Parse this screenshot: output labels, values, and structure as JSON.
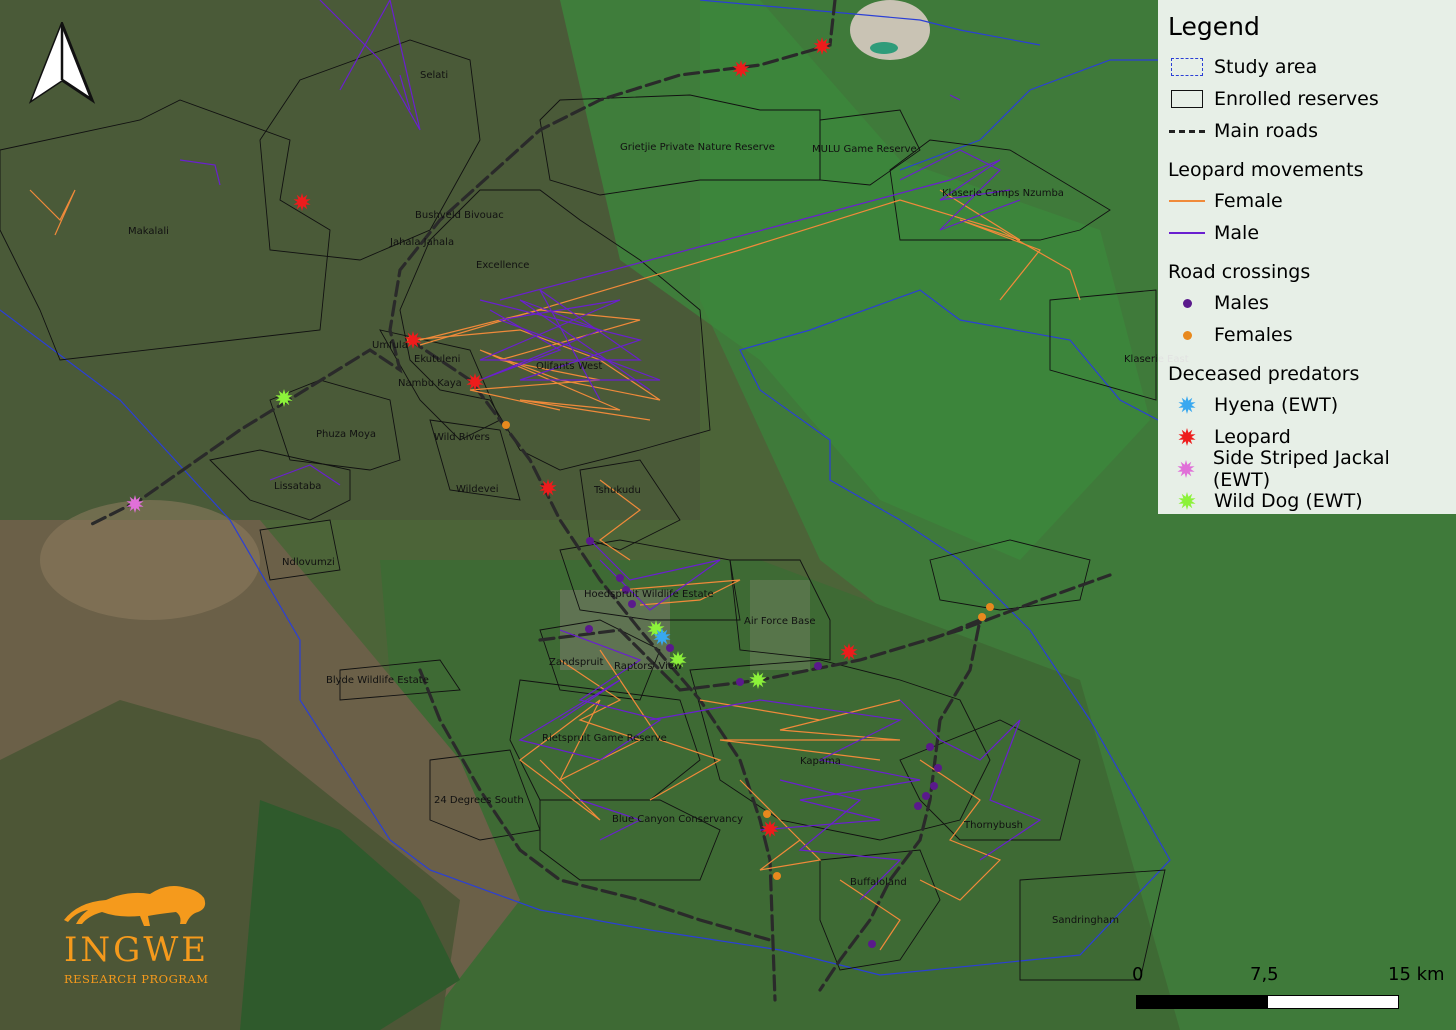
{
  "legend": {
    "title": "Legend",
    "items": {
      "study_area": "Study area",
      "enrolled_reserves": "Enrolled reserves",
      "main_roads": "Main roads",
      "leopard_movements": "Leopard movements",
      "female": "Female",
      "male": "Male",
      "road_crossings": "Road crossings",
      "males": "Males",
      "females": "Females",
      "deceased_predators": "Deceased predators",
      "hyena": "Hyena (EWT)",
      "leopard": "Leopard",
      "jackal": "Side Striped Jackal (EWT)",
      "wild_dog": "Wild Dog (EWT)"
    }
  },
  "colors": {
    "study_area": "#2b3fd6",
    "reserve_outline": "#111111",
    "road": "#2a2a2a",
    "female": "#f08a3a",
    "male": "#6a1fd0",
    "crossing_male": "#5a1a8c",
    "crossing_female": "#e8891e",
    "hyena": "#38a8f0",
    "leopard": "#ee1c1c",
    "jackal": "#e070d8",
    "wild_dog": "#8cf23a"
  },
  "places": {
    "selati": "Selati",
    "makalali": "Makalali",
    "grietjie": "Grietjie Private Nature Reserve",
    "mulu": "MULU Game Reserve",
    "klaserie": "Klaserie Camps Nzumba",
    "bushveld": "Bushveld Bivouac",
    "jahala": "Jahala Jahala",
    "excellence": "Excellence",
    "umfula": "Umfula",
    "ekutuleni": "Ekutuleni",
    "nambu": "Nambu Kaya",
    "olifants": "Olifants West",
    "phuza": "Phuza Moya",
    "wild_rivers": "Wild Rivers",
    "lissataba": "Lissataba",
    "wildevei": "Wildevei",
    "tshukudu": "Tshukudu",
    "ndlovumzi": "Ndlovumzi",
    "hoedspruit": "Hoedspruit Wildlife Estate",
    "air_force": "Air Force Base",
    "zandspruit": "Zandspruit",
    "raptors": "Raptors' View",
    "blyde": "Blyde Wildlife Estate",
    "rietspruit": "Rietspruit Game Reserve",
    "kapama": "Kapama",
    "degrees": "24 Degrees South",
    "blue_canyon": "Blue Canyon Conservancy",
    "thornybush": "Thornybush",
    "buffaloland": "Buffaloland",
    "sandringham": "Sandringham",
    "kl_east": "Klaserie East"
  },
  "scale": {
    "label_0": "0",
    "label_mid": "7,5",
    "label_end": "15 km"
  },
  "logo": {
    "name": "INGWE",
    "subtitle": "RESEARCH PROGRAM"
  }
}
